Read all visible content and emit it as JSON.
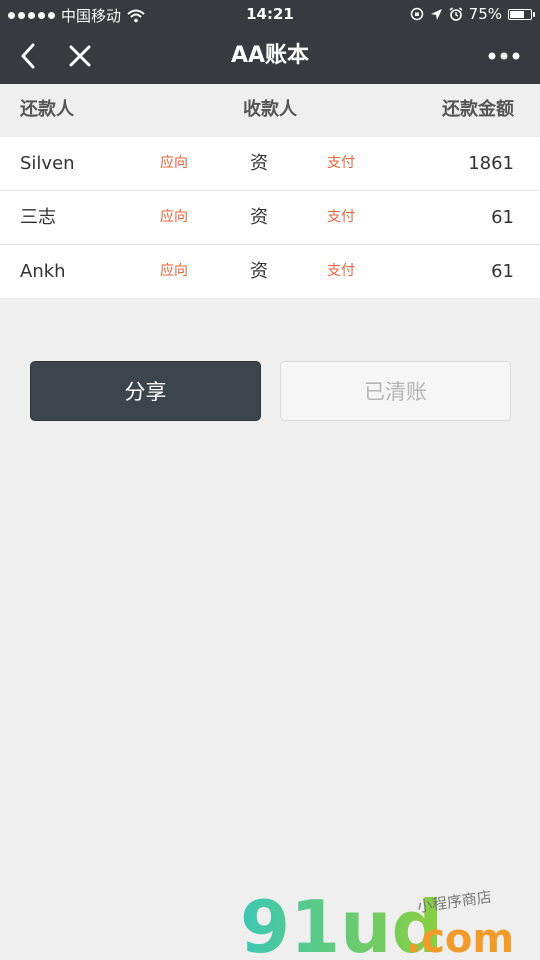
{
  "status_bar": {
    "carrier": "中国移动",
    "time": "14:21",
    "battery": "75%",
    "battery_level": 0.75,
    "icons": [
      "signal-dots-icon",
      "wifi-icon",
      "rotation-lock-icon",
      "location-arrow-icon",
      "alarm-icon",
      "battery-icon"
    ]
  },
  "nav": {
    "title": "AA账本",
    "icons": [
      "back-chevron-icon",
      "close-icon",
      "more-dots-icon"
    ]
  },
  "header": {
    "payer": "还款人",
    "payee": "收款人",
    "amount": "还款金额"
  },
  "rows": [
    {
      "payer": "Silven",
      "verb1": "应向",
      "payee": "资",
      "verb2": "支付",
      "amount": "1861"
    },
    {
      "payer": "三志",
      "verb1": "应向",
      "payee": "资",
      "verb2": "支付",
      "amount": "61"
    },
    {
      "payer": "Ankh",
      "verb1": "应向",
      "payee": "资",
      "verb2": "支付",
      "amount": "61"
    }
  ],
  "buttons": {
    "share": "分享",
    "settled": "已清账"
  },
  "watermark": {
    "logo": "91ud",
    "domain": ".com",
    "tagline": "小程序商店"
  },
  "colors": {
    "bar": "#393a3f",
    "accent_text": "#e8643a",
    "share_button": "#3c444c",
    "background": "#efefef"
  }
}
